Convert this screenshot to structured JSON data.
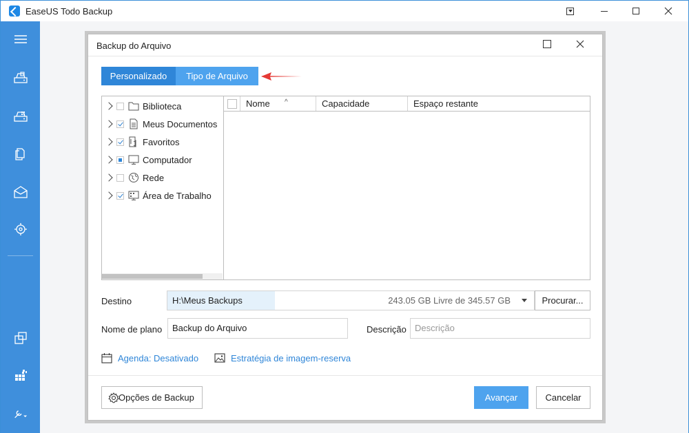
{
  "window": {
    "title": "EaseUS Todo Backup"
  },
  "sidebar": {
    "items": [
      {
        "icon": "menu-icon"
      },
      {
        "icon": "disk-backup-icon"
      },
      {
        "icon": "system-backup-icon"
      },
      {
        "icon": "file-backup-icon"
      },
      {
        "icon": "mail-backup-icon"
      },
      {
        "icon": "smart-backup-icon"
      },
      {
        "icon": "clone-icon"
      },
      {
        "icon": "apps-icon"
      },
      {
        "icon": "tools-icon"
      }
    ]
  },
  "dialog": {
    "title": "Backup do Arquivo",
    "tabs": [
      {
        "label": "Personalizado"
      },
      {
        "label": "Tipo de Arquivo"
      }
    ],
    "tree": [
      {
        "label": "Biblioteca",
        "state": "unchecked",
        "icon": "folder-icon"
      },
      {
        "label": "Meus Documentos",
        "state": "checked",
        "icon": "document-icon"
      },
      {
        "label": "Favoritos",
        "state": "checked",
        "icon": "favorites-icon"
      },
      {
        "label": "Computador",
        "state": "partial",
        "icon": "computer-icon"
      },
      {
        "label": "Rede",
        "state": "unchecked",
        "icon": "network-icon"
      },
      {
        "label": "Área de Trabalho",
        "state": "checked",
        "icon": "desktop-icon"
      }
    ],
    "list": {
      "columns": [
        "Nome",
        "Capacidade",
        "Espaço restante"
      ]
    },
    "destination": {
      "label": "Destino",
      "path": "H:\\Meus Backups",
      "free": "243.05 GB Livre de 345.57 GB",
      "browse_label": "Procurar..."
    },
    "plan": {
      "label": "Nome de plano",
      "value": "Backup do Arquivo"
    },
    "description": {
      "label": "Descrição",
      "placeholder": "Descrição"
    },
    "links": {
      "schedule": "Agenda: Desativado",
      "image_strategy": "Estratégia de imagem-reserva"
    },
    "buttons": {
      "options": "Opções de Backup",
      "next": "Avançar",
      "cancel": "Cancelar"
    }
  },
  "colors": {
    "sidebar": "#3f8fdc",
    "accent": "#4ea3ee",
    "tab_active": "#2f86d8",
    "arrow": "#e53935"
  }
}
